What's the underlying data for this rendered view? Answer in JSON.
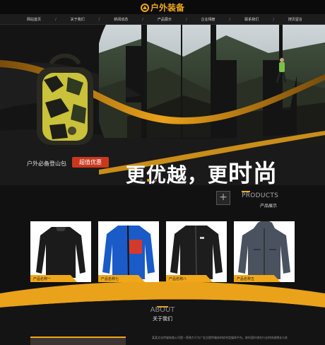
{
  "header": {
    "logo_text": "户外装备",
    "logo_icon": "mountain-emblem-icon"
  },
  "nav": {
    "items": [
      "网站首页",
      "关于我们",
      "新闻动态",
      "产品展示",
      "企业相册",
      "联系我们",
      "搜页留言"
    ],
    "separator": "/"
  },
  "banner": {
    "slogan_part1": "更优越，更",
    "slogan_part2": "时尚",
    "tag_text": "户外必备登山包",
    "tag_button": "超值优惠",
    "slides": 3,
    "active_slide": 1
  },
  "products": {
    "plus_icon": "+",
    "title_en": "PRODUCTS",
    "title_cn": "产品展示",
    "items": [
      {
        "label": "产品名称一",
        "image": "black-base-layer-shirt"
      },
      {
        "label": "产品名称七",
        "image": "blue-red-fleece-jacket"
      },
      {
        "label": "产品名称八",
        "image": "black-softshell-jacket"
      },
      {
        "label": "产品名称五",
        "image": "grey-hooded-jacket"
      }
    ]
  },
  "about": {
    "title_en": "ABOUT",
    "title_cn": "关于我们",
    "text": "某某文化传媒有限公司是一家致力于为广告主提供服务的综合型媒体平台。依托国内领先行业的快速增长与发"
  },
  "colors": {
    "accent": "#f0a81a",
    "button": "#c9381e",
    "background": "#111111"
  }
}
